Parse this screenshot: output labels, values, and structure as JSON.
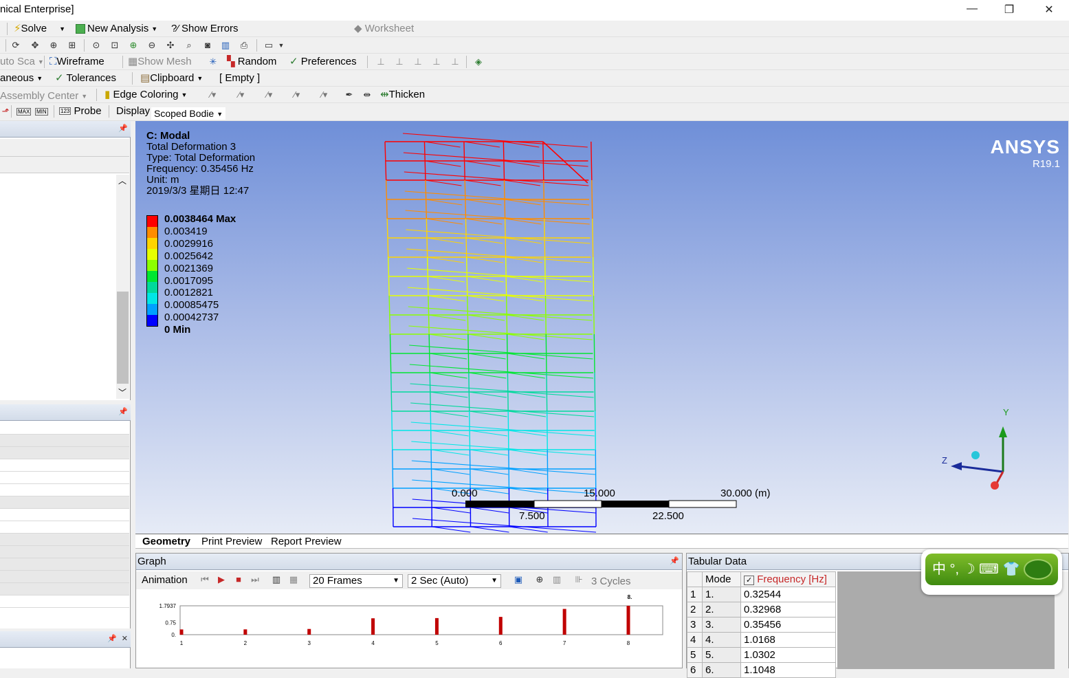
{
  "window": {
    "title": "nical Enterprise]",
    "minimize_glyph": "—",
    "restore_glyph": "❐",
    "close_glyph": "✕"
  },
  "toolbar1": {
    "solve": "Solve",
    "new_analysis": "New Analysis",
    "show_errors": "Show Errors",
    "worksheet": "Worksheet"
  },
  "toolbar3": {
    "auto_scale": "uto Sca",
    "wireframe": "Wireframe",
    "show_mesh": "Show Mesh",
    "random": "Random",
    "preferences": "Preferences"
  },
  "toolbar4": {
    "miscellaneous": "aneous",
    "tolerances": "Tolerances",
    "clipboard": "Clipboard",
    "empty": "[ Empty ]"
  },
  "toolbar5": {
    "assembly_center": "Assembly Center",
    "edge_coloring": "Edge Coloring",
    "thicken": "Thicken"
  },
  "toolbar6": {
    "max_label": "MAX",
    "min_label": "MIN",
    "probe_badge": "123",
    "probe": "Probe",
    "display": "Display",
    "scoped_bodies": "Scoped Bodie"
  },
  "viewport": {
    "analysis": "C: Modal",
    "result_name": "Total Deformation 3",
    "type_line": "Type: Total Deformation",
    "frequency_line": "Frequency: 0.35456 Hz",
    "unit_line": "Unit: m",
    "date_line": "2019/3/3 星期日 12:47",
    "brand": "ANSYS",
    "version": "R19.1",
    "legend": {
      "max": "0.0038464 Max",
      "levels": [
        "0.003419",
        "0.0029916",
        "0.0025642",
        "0.0021369",
        "0.0017095",
        "0.0012821",
        "0.00085475",
        "0.00042737"
      ],
      "min": "0 Min",
      "colors": [
        "#ff0000",
        "#ff8c00",
        "#ffd400",
        "#e6ff00",
        "#8cff00",
        "#00e632",
        "#00d99c",
        "#00e6e6",
        "#00a0ff",
        "#0000ff"
      ]
    },
    "scale": {
      "l0": "0.000",
      "l15": "15.000",
      "l30": "30.000 (m)",
      "l7": "7.500",
      "l22": "22.500"
    },
    "triad": {
      "y": "Y",
      "z": "Z"
    }
  },
  "tabs": [
    "Geometry",
    "Print Preview",
    "Report Preview"
  ],
  "graph": {
    "title": "Graph",
    "animation": "Animation",
    "frames": "20 Frames",
    "duration": "2 Sec (Auto)",
    "cycles": "3 Cycles",
    "chart": {
      "y_ticks": [
        "1.7937",
        "0.75",
        "0."
      ],
      "x_ticks": [
        "1",
        "2",
        "3",
        "4",
        "5",
        "6",
        "7",
        "8"
      ],
      "highlight_label": "8.",
      "values": [
        0.32544,
        0.32968,
        0.35456,
        1.0168,
        1.0302,
        1.1048,
        1.6,
        1.7937
      ],
      "ymax": 1.7937
    }
  },
  "tabular": {
    "title": "Tabular Data",
    "col_mode": "Mode",
    "col_freq": "Frequency [Hz]",
    "rows": [
      {
        "n": "1",
        "mode": "1.",
        "freq": "0.32544"
      },
      {
        "n": "2",
        "mode": "2.",
        "freq": "0.32968"
      },
      {
        "n": "3",
        "mode": "3.",
        "freq": "0.35456"
      },
      {
        "n": "4",
        "mode": "4.",
        "freq": "1.0168"
      },
      {
        "n": "5",
        "mode": "5.",
        "freq": "1.0302"
      },
      {
        "n": "6",
        "mode": "6.",
        "freq": "1.1048"
      }
    ]
  },
  "ime": {
    "text": "中 °, ☽ ⌨ 👕"
  }
}
